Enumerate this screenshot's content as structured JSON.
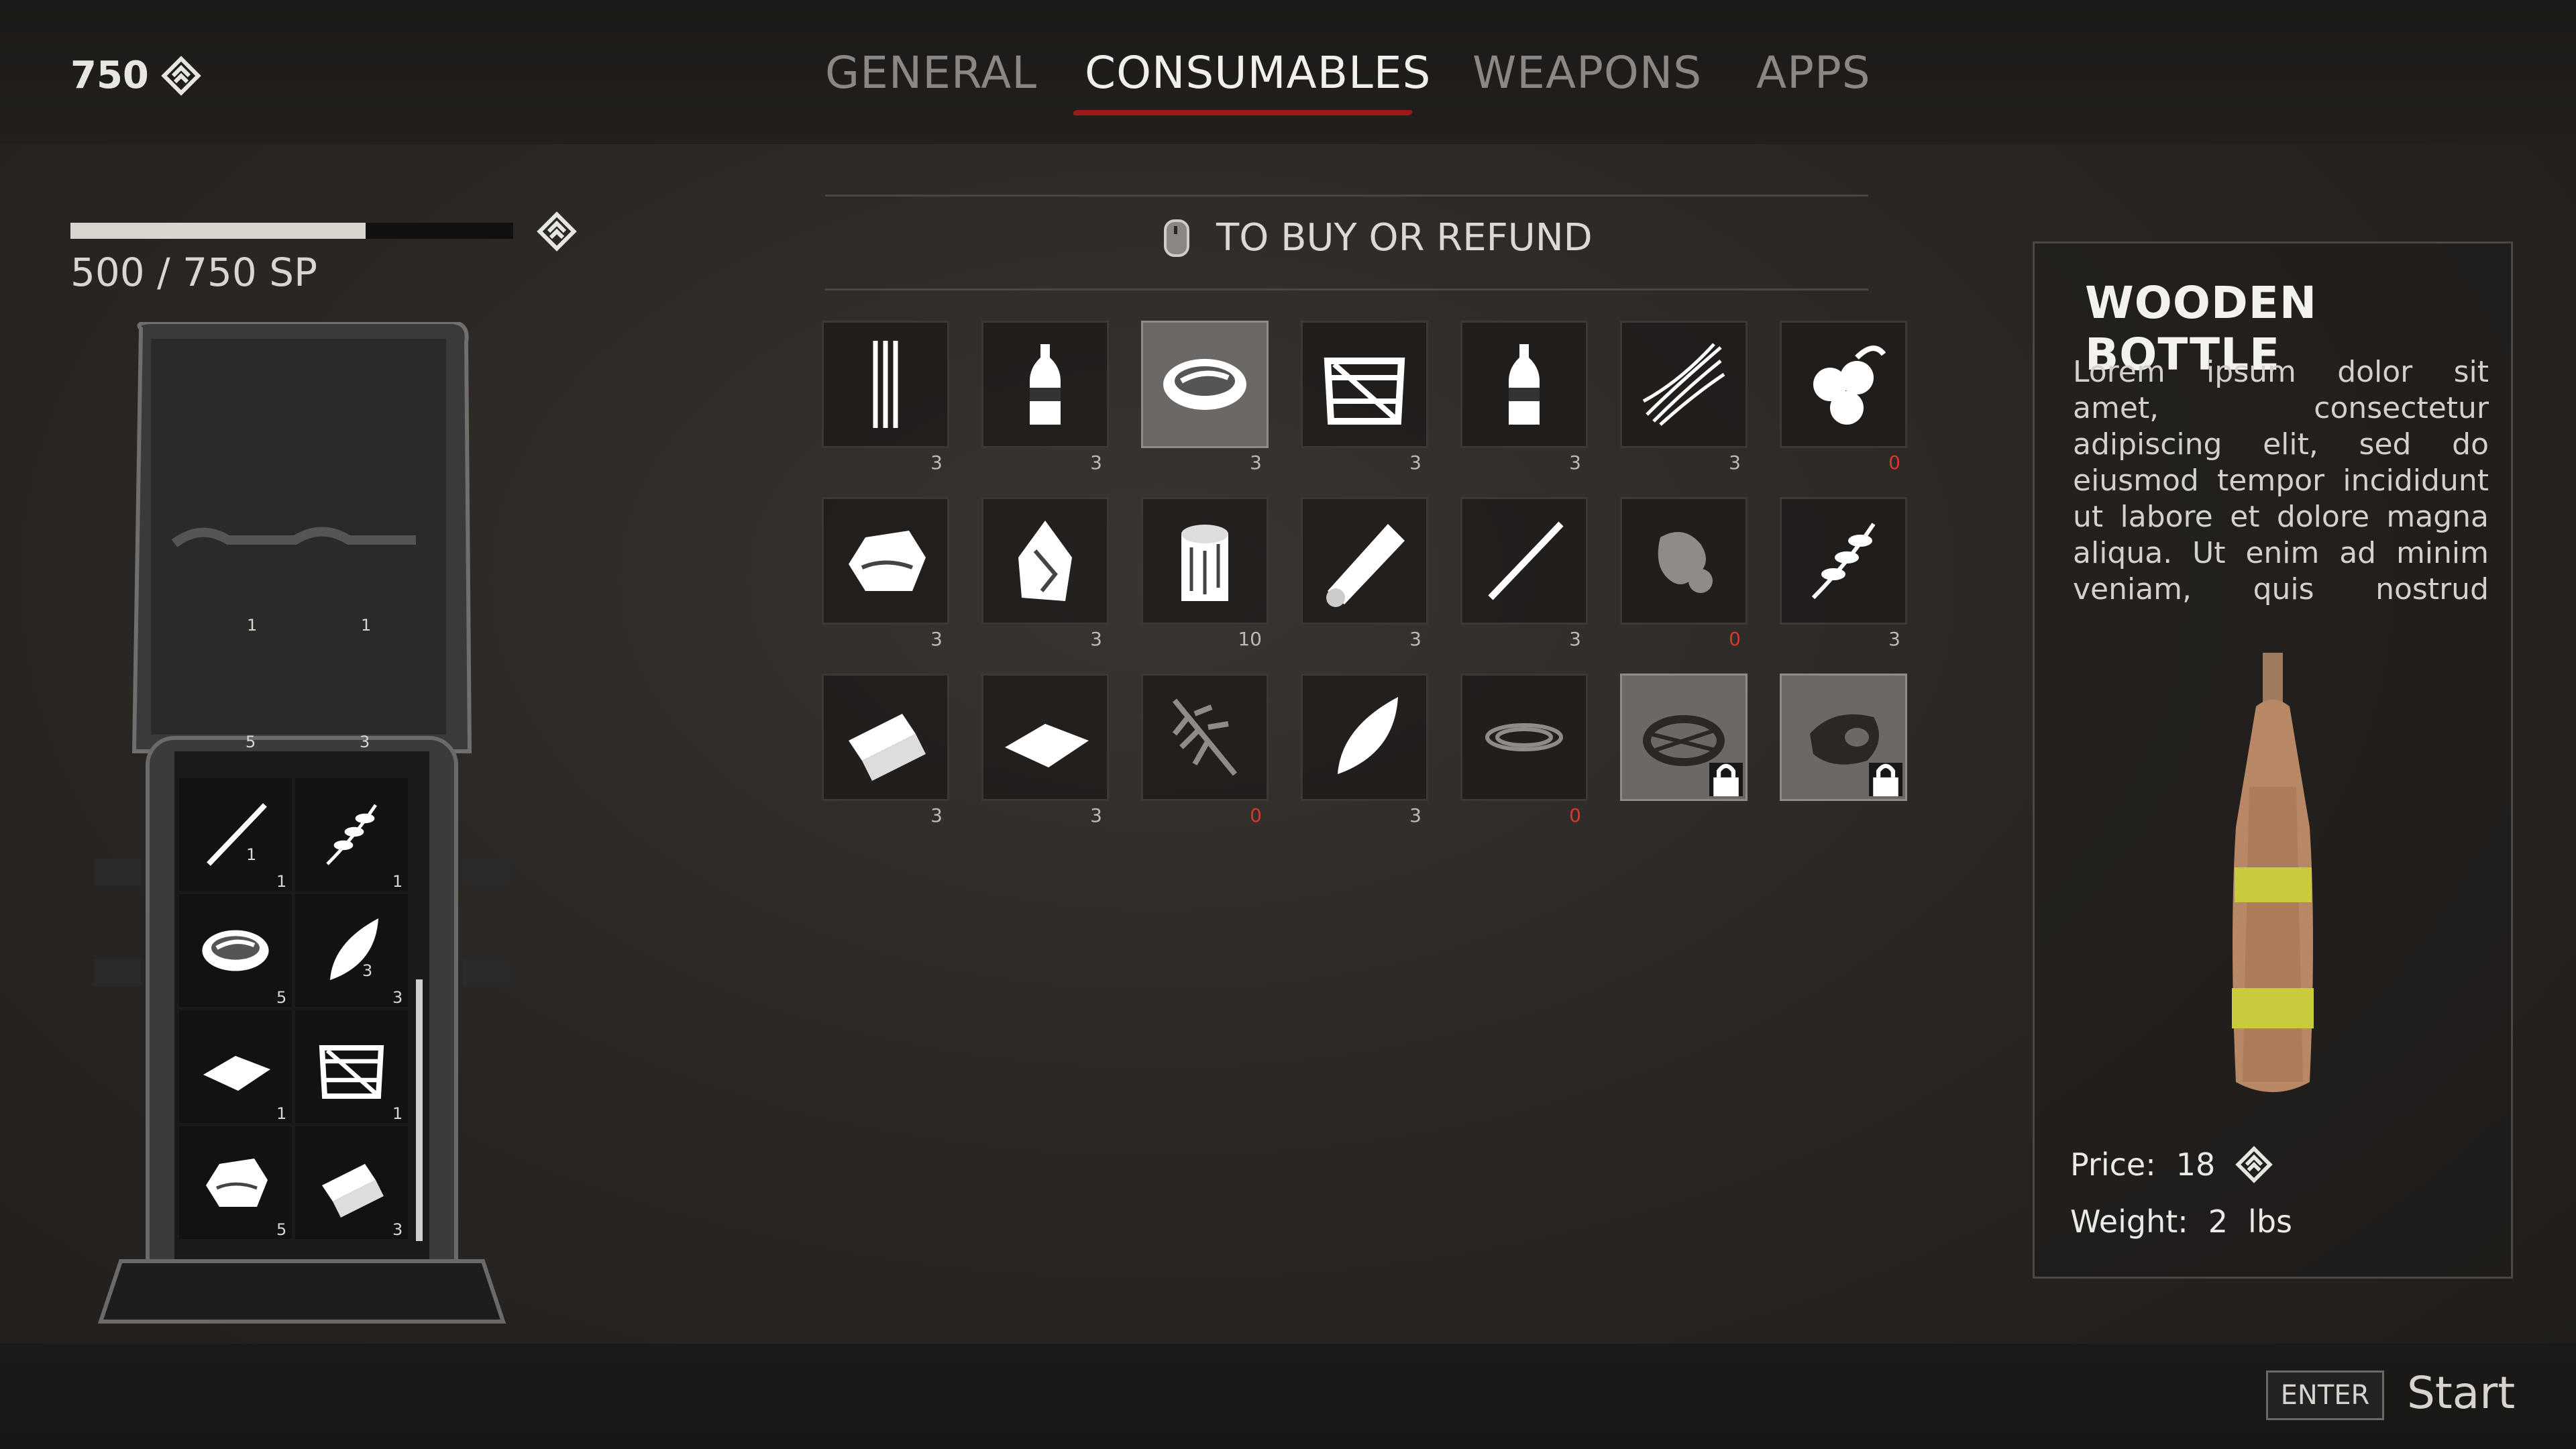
{
  "currency": {
    "amount": "750"
  },
  "tabs": [
    {
      "label": "GENERAL"
    },
    {
      "label": "CONSUMABLES"
    },
    {
      "label": "WEAPONS"
    },
    {
      "label": "APPS"
    }
  ],
  "active_tab": "CONSUMABLES",
  "skill_points": {
    "text": "500 / 750 SP",
    "fill_fraction": 0.667
  },
  "hint": {
    "label": "TO BUY OR REFUND"
  },
  "items": [
    {
      "icon": "sticks-icon",
      "qty": "3"
    },
    {
      "icon": "plastic-bottle-icon",
      "qty": "3"
    },
    {
      "icon": "bowl-icon",
      "qty": "3",
      "selected": true
    },
    {
      "icon": "crate-icon",
      "qty": "3"
    },
    {
      "icon": "bottle-icon",
      "qty": "3"
    },
    {
      "icon": "fiber-icon",
      "qty": "3"
    },
    {
      "icon": "berries-icon",
      "qty": "0"
    },
    {
      "icon": "rock-icon",
      "qty": "3"
    },
    {
      "icon": "flint-icon",
      "qty": "3"
    },
    {
      "icon": "log-stump-icon",
      "qty": "10"
    },
    {
      "icon": "log-icon",
      "qty": "3"
    },
    {
      "icon": "stick-icon",
      "qty": "3"
    },
    {
      "icon": "ginger-root-icon",
      "qty": "0"
    },
    {
      "icon": "herb-icon",
      "qty": "3"
    },
    {
      "icon": "firewood-icon",
      "qty": "3"
    },
    {
      "icon": "paper-icon",
      "qty": "3"
    },
    {
      "icon": "pine-branch-icon",
      "qty": "0"
    },
    {
      "icon": "leaf-icon",
      "qty": "3"
    },
    {
      "icon": "rope-icon",
      "qty": "0"
    },
    {
      "icon": "nest-icon",
      "qty": "",
      "locked": true
    },
    {
      "icon": "meat-icon",
      "qty": "",
      "locked": true
    }
  ],
  "backpack": {
    "lid_qty": [
      "1",
      "1"
    ],
    "row_qty": [
      "5",
      "3"
    ],
    "slots": [
      {
        "icon": "stick-icon",
        "qty": "1",
        "qty2": "1"
      },
      {
        "icon": "herb-icon",
        "qty": "1"
      },
      {
        "icon": "bowl-icon",
        "qty": "5"
      },
      {
        "icon": "leaf-icon",
        "qty": "3",
        "qty2": "3"
      },
      {
        "icon": "paper-icon",
        "qty": "1"
      },
      {
        "icon": "crate-icon",
        "qty": "1"
      },
      {
        "icon": "rock-icon",
        "qty": "5"
      },
      {
        "icon": "firewood-icon",
        "qty": "3"
      }
    ]
  },
  "detail": {
    "title": "WOODEN BOTTLE",
    "description": "Lorem ipsum dolor sit amet, consectetur adipiscing elit, sed do eiusmod tempor incididunt ut labore et dolore magna aliqua. Ut enim ad minim veniam, quis nostrud exercitation ullamco laboris nisi ut aliquip ex ea",
    "price_label": "Price:",
    "price_value": "18",
    "weight_label": "Weight:",
    "weight_value": "2",
    "weight_unit": "lbs"
  },
  "footer": {
    "key": "ENTER",
    "action": "Start"
  },
  "colors": {
    "accent_red": "#9c1a1a",
    "zero_qty": "#d7372d"
  }
}
